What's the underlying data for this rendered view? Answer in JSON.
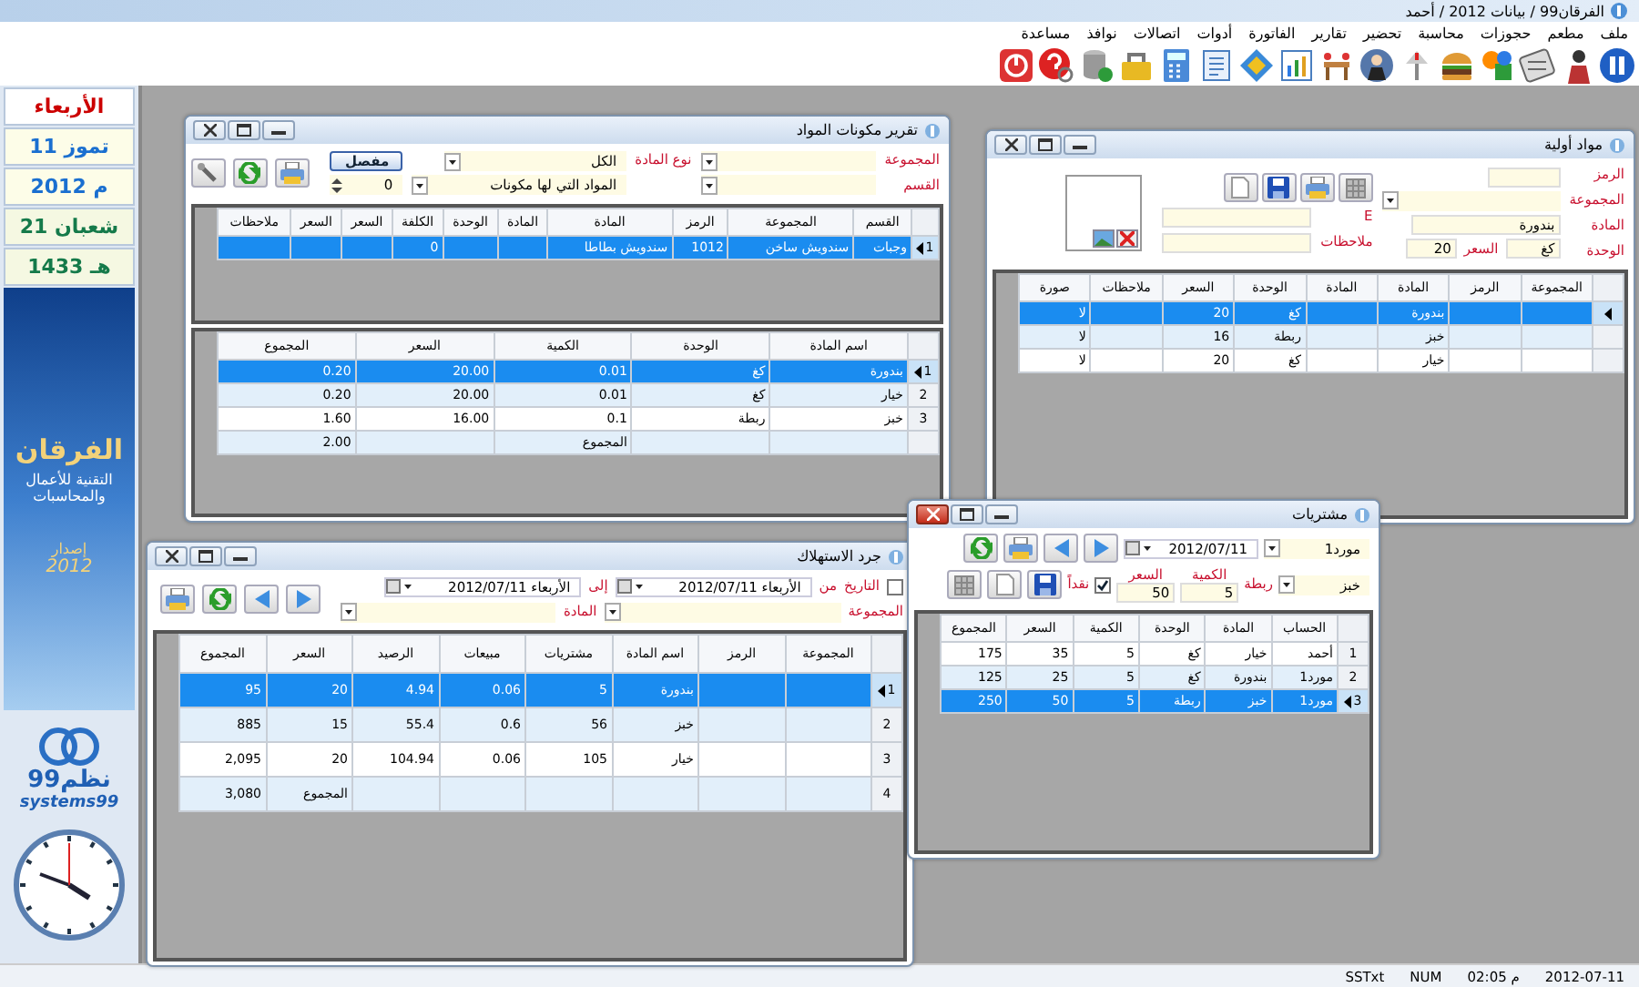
{
  "window": {
    "title": "الفرقان99 / بيانات 2012 / أحمد"
  },
  "menu": [
    "ملف",
    "مطعم",
    "حجوزات",
    "محاسبة",
    "تحضير",
    "تقارير",
    "الفاتورة",
    "أدوات",
    "اتصالات",
    "نوافذ",
    "مساعدة"
  ],
  "sidebar": {
    "day": "الأربعاء",
    "dates": [
      {
        "text": "11 تموز",
        "kind": "gregorian"
      },
      {
        "text": "2012 م",
        "kind": "gregorian"
      },
      {
        "text": "21 شعبان",
        "kind": "hijri"
      },
      {
        "text": "1433 هـ",
        "kind": "hijri"
      }
    ],
    "logo_title": "الفرقان",
    "logo_subtitle": [
      "التقنية للأعمال",
      "والمحاسبات"
    ],
    "version_label": "إصدار",
    "version_year": "2012",
    "brand_arabic": "نظم99",
    "brand_latin": "systems99"
  },
  "components_report": {
    "title": "تقرير مكونات المواد",
    "active": false,
    "group_label": "المجموعة",
    "section_label": "القسم",
    "type_label": "نوع المادة",
    "type_value": "الكل",
    "filter_value": "المواد التي لها مكونات",
    "detail_button": "مفصل",
    "count_value": "0",
    "items_grid": {
      "columns": [
        "القسم",
        "المجموعة",
        "الرمز",
        "المادة",
        "المادة",
        "الوحدة",
        "الكلفة",
        "السعر",
        "السعر",
        "ملاحظات"
      ],
      "rows": [
        {
          "number": "1",
          "selected": true,
          "cells": [
            "وجبات",
            "سندويش ساخن",
            "1012",
            "سندويش بطاطا",
            null,
            null,
            "0",
            null,
            null,
            null
          ]
        }
      ]
    },
    "ingredients_grid": {
      "columns": [
        "اسم المادة",
        "الوحدة",
        "الكمية",
        "السعر",
        "المجموع"
      ],
      "rows": [
        {
          "number": "1",
          "selected": true,
          "cells": [
            "بندورة",
            "كغ",
            "0.01",
            "20.00",
            "0.20"
          ]
        },
        {
          "number": "2",
          "selected": false,
          "cells": [
            "خيار",
            "كغ",
            "0.01",
            "20.00",
            "0.20"
          ]
        },
        {
          "number": "3",
          "selected": false,
          "cells": [
            "خبز",
            "ربطة",
            "0.1",
            "16.00",
            "1.60"
          ]
        },
        {
          "selected": false,
          "cells": [
            null,
            null,
            "المجموع",
            null,
            "2.00"
          ]
        }
      ]
    }
  },
  "raw_materials": {
    "title": "مواد أولية",
    "active": false,
    "code_label": "الرمز",
    "group_label": "المجموعة",
    "name_label": "المادة",
    "name_value": "بندورة",
    "english_label": "E",
    "unit_label": "الوحدة",
    "unit_value": "كغ",
    "price_label": "السعر",
    "price_value": "20",
    "notes_label": "ملاحظات",
    "grid": {
      "columns": [
        "المجموعة",
        "الرمز",
        "المادة",
        "المادة",
        "الوحدة",
        "السعر",
        "ملاحظات",
        "صورة"
      ],
      "rows": [
        {
          "selected": true,
          "cells": [
            null,
            null,
            "بندورة",
            null,
            "كغ",
            "20",
            null,
            "لا"
          ]
        },
        {
          "selected": false,
          "cells": [
            null,
            null,
            "خبز",
            null,
            "ربطة",
            "16",
            null,
            "لا"
          ]
        },
        {
          "selected": false,
          "cells": [
            null,
            null,
            "خيار",
            null,
            "كغ",
            "20",
            null,
            "لا"
          ]
        }
      ]
    }
  },
  "consumption_inventory": {
    "title": "جرد الاستهلاك",
    "active": false,
    "date_checked": false,
    "date_label": "التاريخ",
    "from_label": "من",
    "from_value": "الأربعاء  2012/07/11",
    "to_label": "إلى",
    "to_value": "الأربعاء  2012/07/11",
    "group_label": "المجموعة",
    "material_label": "المادة",
    "grid": {
      "columns": [
        "المجموعة",
        "الرمز",
        "اسم المادة",
        "مشتريات",
        "مبيعات",
        "الرصيد",
        "السعر",
        "المجموع"
      ],
      "rows": [
        {
          "number": "1",
          "selected": true,
          "cells": [
            null,
            null,
            "بندورة",
            "5",
            "0.06",
            "4.94",
            "20",
            "95"
          ]
        },
        {
          "number": "2",
          "selected": false,
          "cells": [
            null,
            null,
            "خبز",
            "56",
            "0.6",
            "55.4",
            "15",
            "885"
          ]
        },
        {
          "number": "3",
          "selected": false,
          "cells": [
            null,
            null,
            "خيار",
            "105",
            "0.06",
            "104.94",
            "20",
            "2,095"
          ]
        },
        {
          "number": "4",
          "selected": false,
          "cells": [
            null,
            null,
            null,
            null,
            null,
            null,
            "المجموع",
            "3,080"
          ]
        }
      ]
    }
  },
  "purchases": {
    "title": "مشتريات",
    "active": true,
    "supplier_value": "مورد1",
    "date_value": "2012/07/11",
    "item_value": "خبز",
    "unit_value": "ربطة",
    "quantity_label": "الكمية",
    "quantity_value": "5",
    "price_label": "السعر",
    "price_value": "50",
    "cash_label": "نقداً",
    "cash_checked": true,
    "grid": {
      "columns": [
        "الحساب",
        "المادة",
        "الوحدة",
        "الكمية",
        "السعر",
        "المجموع"
      ],
      "rows": [
        {
          "number": "1",
          "selected": false,
          "cells": [
            "أحمد",
            "خيار",
            "كغ",
            "5",
            "35",
            "175"
          ]
        },
        {
          "number": "2",
          "selected": false,
          "cells": [
            "مورد1",
            "بندورة",
            "كغ",
            "5",
            "25",
            "125"
          ]
        },
        {
          "number": "3",
          "selected": true,
          "cells": [
            "مورد1",
            "خبز",
            "ربطة",
            "5",
            "50",
            "250"
          ]
        }
      ]
    }
  },
  "status_bar": [
    "2012-07-11",
    "02:05 م",
    "NUM",
    "SSTxt"
  ]
}
